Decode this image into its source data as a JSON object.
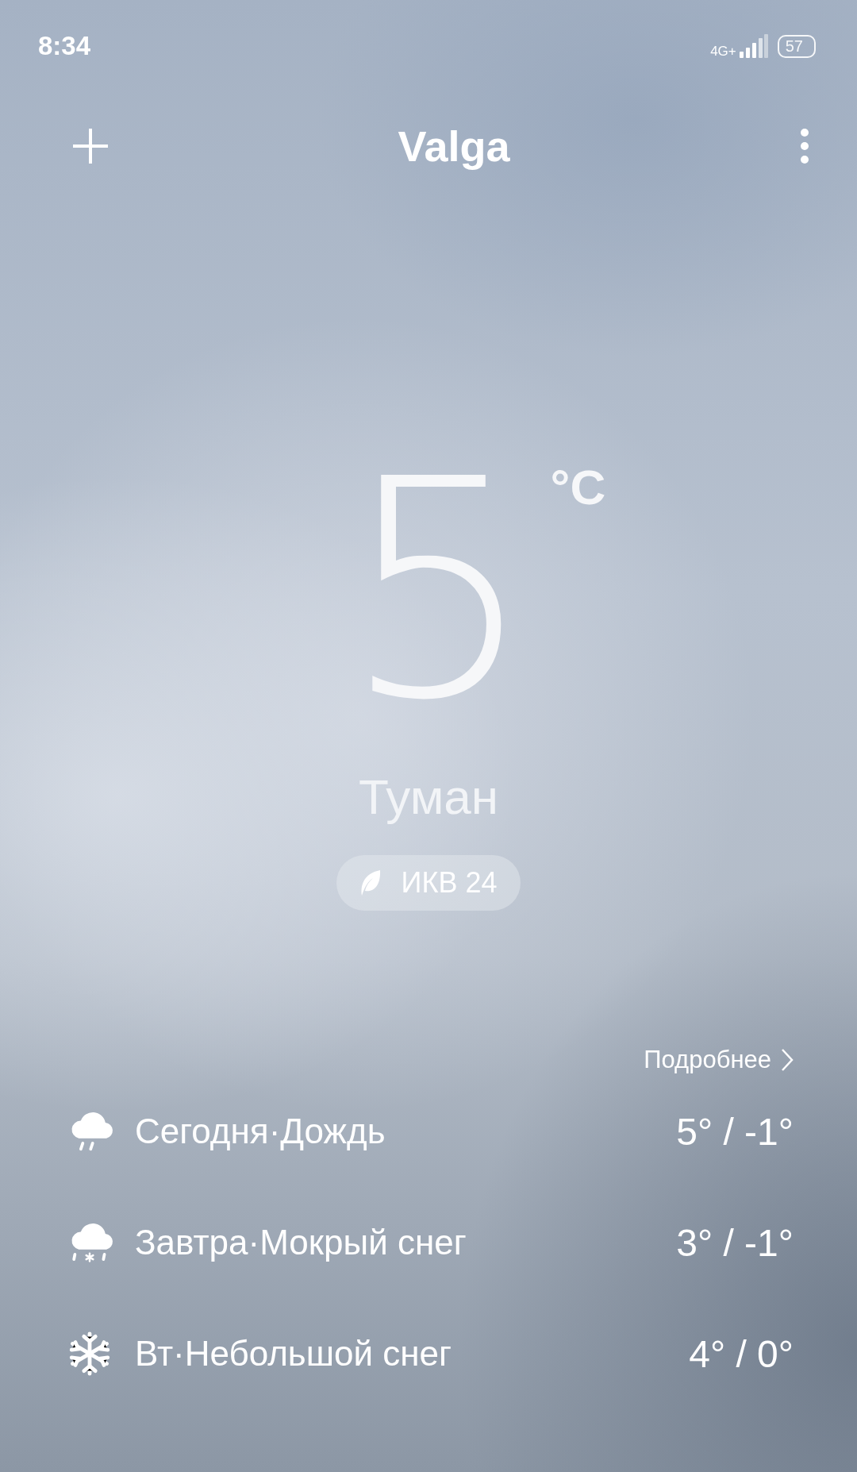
{
  "status_bar": {
    "time": "8:34",
    "network": "4G+",
    "battery": "57"
  },
  "header": {
    "city": "Valga"
  },
  "current": {
    "temperature": "5",
    "unit": "°C",
    "condition": "Туман",
    "aqi": "ИКВ 24"
  },
  "forecast": {
    "more_link": "Подробнее",
    "days": [
      {
        "kind": "rain",
        "label": "Сегодня·Дождь",
        "temps": "5° / -1°"
      },
      {
        "kind": "sleet",
        "label": "Завтра·Мокрый снег",
        "temps": "3° / -1°"
      },
      {
        "kind": "snow",
        "label": "Вт·Небольшой снег",
        "temps": "4° / 0°"
      }
    ]
  }
}
